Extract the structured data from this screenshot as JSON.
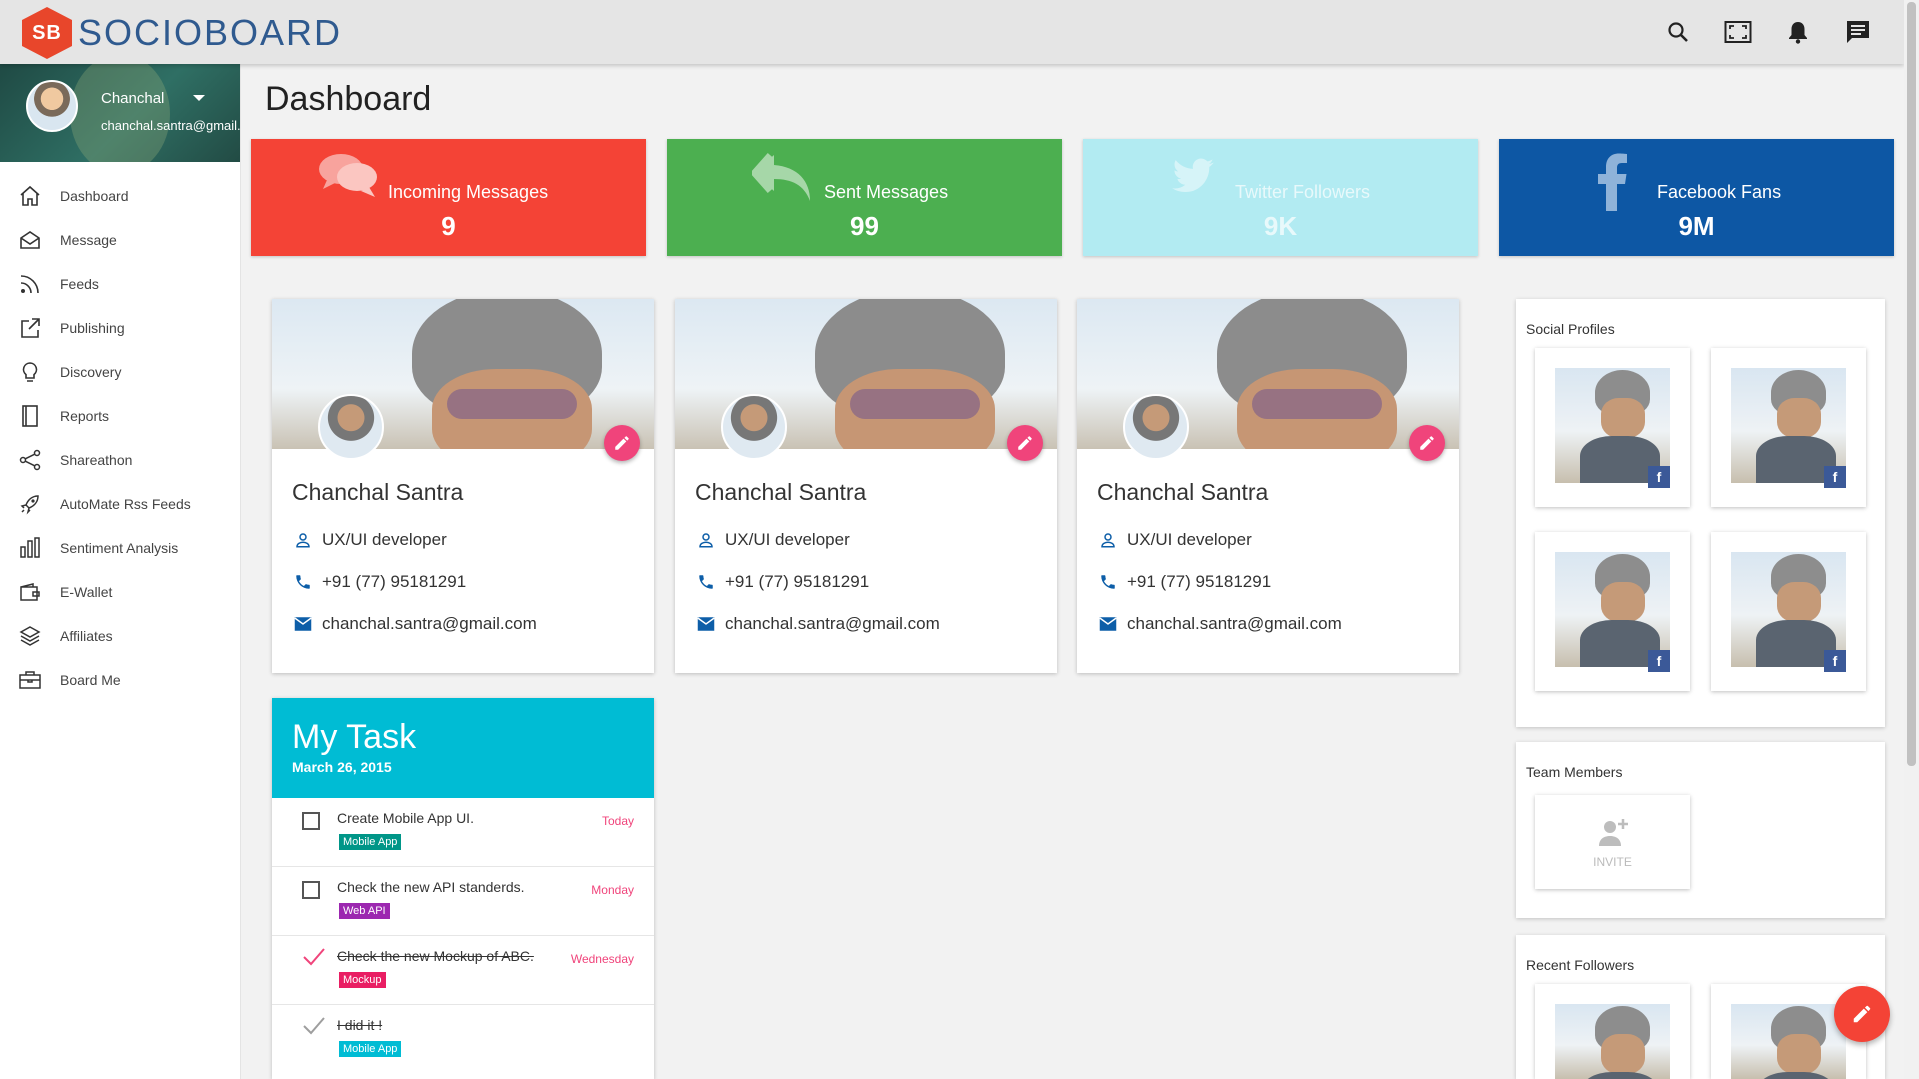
{
  "app": {
    "logo_mark": "SB",
    "name": "SOCIOBOARD"
  },
  "header_icons": [
    "search-icon",
    "fullscreen-icon",
    "bell-icon",
    "chat-icon"
  ],
  "user": {
    "name": "Chanchal",
    "email": "chanchal.santra@gmail.com"
  },
  "sidebar": {
    "items": [
      {
        "label": "Dashboard",
        "icon": "home-icon"
      },
      {
        "label": "Message",
        "icon": "envelope-icon"
      },
      {
        "label": "Feeds",
        "icon": "rss-icon"
      },
      {
        "label": "Publishing",
        "icon": "share-box-icon"
      },
      {
        "label": "Discovery",
        "icon": "lightbulb-icon"
      },
      {
        "label": "Reports",
        "icon": "book-icon"
      },
      {
        "label": "Shareathon",
        "icon": "share-icon"
      },
      {
        "label": "AutoMate Rss Feeds",
        "icon": "rocket-icon"
      },
      {
        "label": "Sentiment Analysis",
        "icon": "bar-chart-icon"
      },
      {
        "label": "E-Wallet",
        "icon": "wallet-icon"
      },
      {
        "label": "Affiliates",
        "icon": "layers-icon"
      },
      {
        "label": "Board Me",
        "icon": "briefcase-icon"
      }
    ]
  },
  "page": {
    "title": "Dashboard"
  },
  "stats": [
    {
      "label": "Incoming Messages",
      "value": "9",
      "color": "#f44336",
      "icon": "chat-bubbles-icon"
    },
    {
      "label": "Sent Messages",
      "value": "99",
      "color": "#4caf50",
      "icon": "reply-all-icon"
    },
    {
      "label": "Twitter Followers",
      "value": "9K",
      "color": "#b2ebf2",
      "icon": "twitter-icon"
    },
    {
      "label": "Facebook Fans",
      "value": "9M",
      "color": "#0d57a4",
      "icon": "facebook-icon"
    }
  ],
  "profile_cards": [
    {
      "name": "Chanchal Santra",
      "role": "UX/UI developer",
      "phone": "+91 (77) 95181291",
      "email": "chanchal.santra@gmail.com"
    },
    {
      "name": "Chanchal Santra",
      "role": "UX/UI developer",
      "phone": "+91 (77) 95181291",
      "email": "chanchal.santra@gmail.com"
    },
    {
      "name": "Chanchal Santra",
      "role": "UX/UI developer",
      "phone": "+91 (77) 95181291",
      "email": "chanchal.santra@gmail.com"
    }
  ],
  "task": {
    "title": "My Task",
    "date": "March 26, 2015",
    "items": [
      {
        "text": "Create Mobile App UI.",
        "day": "Today",
        "tag": "Mobile App",
        "tag_color": "#009688",
        "done": false
      },
      {
        "text": "Check the new API standerds.",
        "day": "Monday",
        "tag": "Web API",
        "tag_color": "#9c27b0",
        "done": false
      },
      {
        "text": "Check the new Mockup of ABC.",
        "day": "Wednesday",
        "tag": "Mockup",
        "tag_color": "#e91e63",
        "done": true
      },
      {
        "text": "I did it !",
        "day": "",
        "tag": "Mobile App",
        "tag_color": "#00bcd4",
        "done": true
      }
    ]
  },
  "social_profiles": {
    "title": "Social Profiles",
    "badge": "f"
  },
  "team_members": {
    "title": "Team Members",
    "invite_label": "INVITE"
  },
  "recent_followers": {
    "title": "Recent Followers"
  }
}
